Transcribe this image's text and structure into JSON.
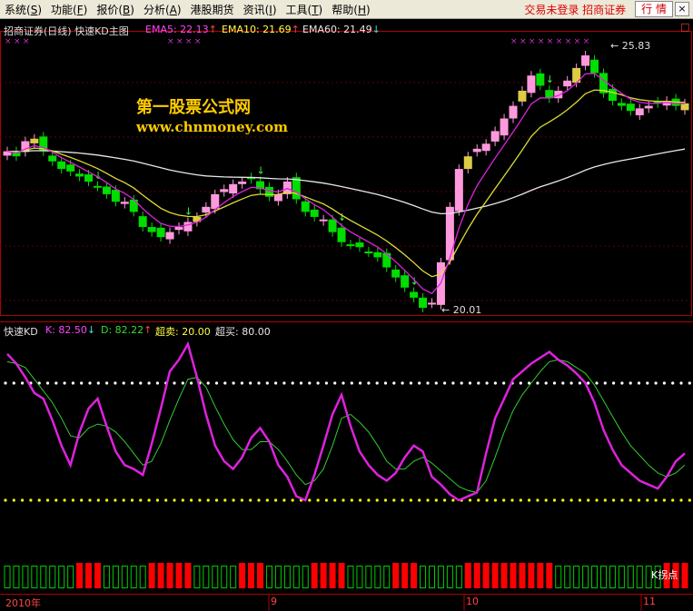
{
  "menu": {
    "items": [
      {
        "label": "系统",
        "key": "S"
      },
      {
        "label": "功能",
        "key": "F"
      },
      {
        "label": "报价",
        "key": "B"
      },
      {
        "label": "分析",
        "key": "A"
      },
      {
        "label": "港股期货",
        "key": ""
      },
      {
        "label": "资讯",
        "key": "I"
      },
      {
        "label": "工具",
        "key": "T"
      },
      {
        "label": "帮助",
        "key": "H"
      }
    ],
    "login_text": "交易未登录  招商证券",
    "quote_button": "行 情",
    "close_button": "×"
  },
  "main_header": {
    "title": "招商证券(日线) 快速KD主图",
    "ema5": "EMA5: 22.13",
    "ema5_arrow": "↑",
    "ema10": "EMA10: 21.69",
    "ema10_arrow": "↑",
    "ema60": "EMA60: 21.49",
    "ema60_arrow": "↓"
  },
  "watermark": {
    "line1": "第一股票公式网",
    "line2": "www.chnmoney.com"
  },
  "price_labels": {
    "high": "25.83",
    "low": "20.01"
  },
  "sub_header": {
    "name": "快速KD",
    "k": "K: 82.50",
    "k_arrow": "↓",
    "d": "D: 82.22",
    "d_arrow": "↑",
    "oversold": "超卖: 20.00",
    "overbought": "超买: 80.00"
  },
  "k_turn_label": "K拐点",
  "time_axis": [
    {
      "label": "2010年"
    },
    {
      "label": "9"
    },
    {
      "label": "10"
    },
    {
      "label": "11"
    }
  ],
  "colors": {
    "up_fill": "#ff99dd",
    "up_fill_alt": "#ddcc44",
    "down_fill": "#00dd00",
    "ema5": "#dd22dd",
    "ema10": "#dddd33",
    "ema60": "#e8e8e8",
    "k_line": "#dd22dd",
    "d_line": "#33cc33",
    "level_high": "#ffffff",
    "level_low": "#ffff00",
    "bar_red": "#ff0000",
    "bar_green": "#00cc00"
  },
  "chart_data": {
    "type": "line",
    "k_series": [
      95,
      90,
      83,
      75,
      72,
      61,
      48,
      38,
      55,
      67,
      72,
      58,
      45,
      38,
      36,
      33,
      49,
      67,
      86,
      92,
      100,
      83,
      64,
      48,
      40,
      36,
      42,
      52,
      57,
      50,
      38,
      32,
      22,
      20,
      33,
      48,
      64,
      74,
      58,
      45,
      38,
      33,
      30,
      34,
      42,
      48,
      45,
      32,
      28,
      23,
      20,
      22,
      24,
      44,
      62,
      72,
      82,
      86,
      90,
      93,
      96,
      92,
      89,
      85,
      80,
      70,
      56,
      46,
      38,
      34,
      30,
      28,
      26,
      32,
      40,
      44
    ],
    "d_series": [
      91,
      90,
      88,
      82,
      76,
      70,
      62,
      53,
      52,
      57,
      59,
      58,
      55,
      50,
      44,
      38,
      40,
      49,
      61,
      72,
      82,
      83,
      78,
      68,
      59,
      51,
      46,
      46,
      50,
      50,
      46,
      40,
      33,
      28,
      30,
      36,
      48,
      62,
      64,
      60,
      55,
      48,
      40,
      36,
      36,
      40,
      42,
      39,
      35,
      31,
      27,
      25,
      24,
      30,
      42,
      55,
      66,
      74,
      80,
      86,
      91,
      92,
      91,
      88,
      85,
      79,
      71,
      63,
      55,
      48,
      43,
      38,
      34,
      32,
      34,
      38
    ],
    "oversold": 20,
    "overbought": 80,
    "ema5_last": 22.13,
    "ema10_last": 21.69,
    "ema60_last": 21.49,
    "price_high": 25.83,
    "price_low": 20.01
  }
}
